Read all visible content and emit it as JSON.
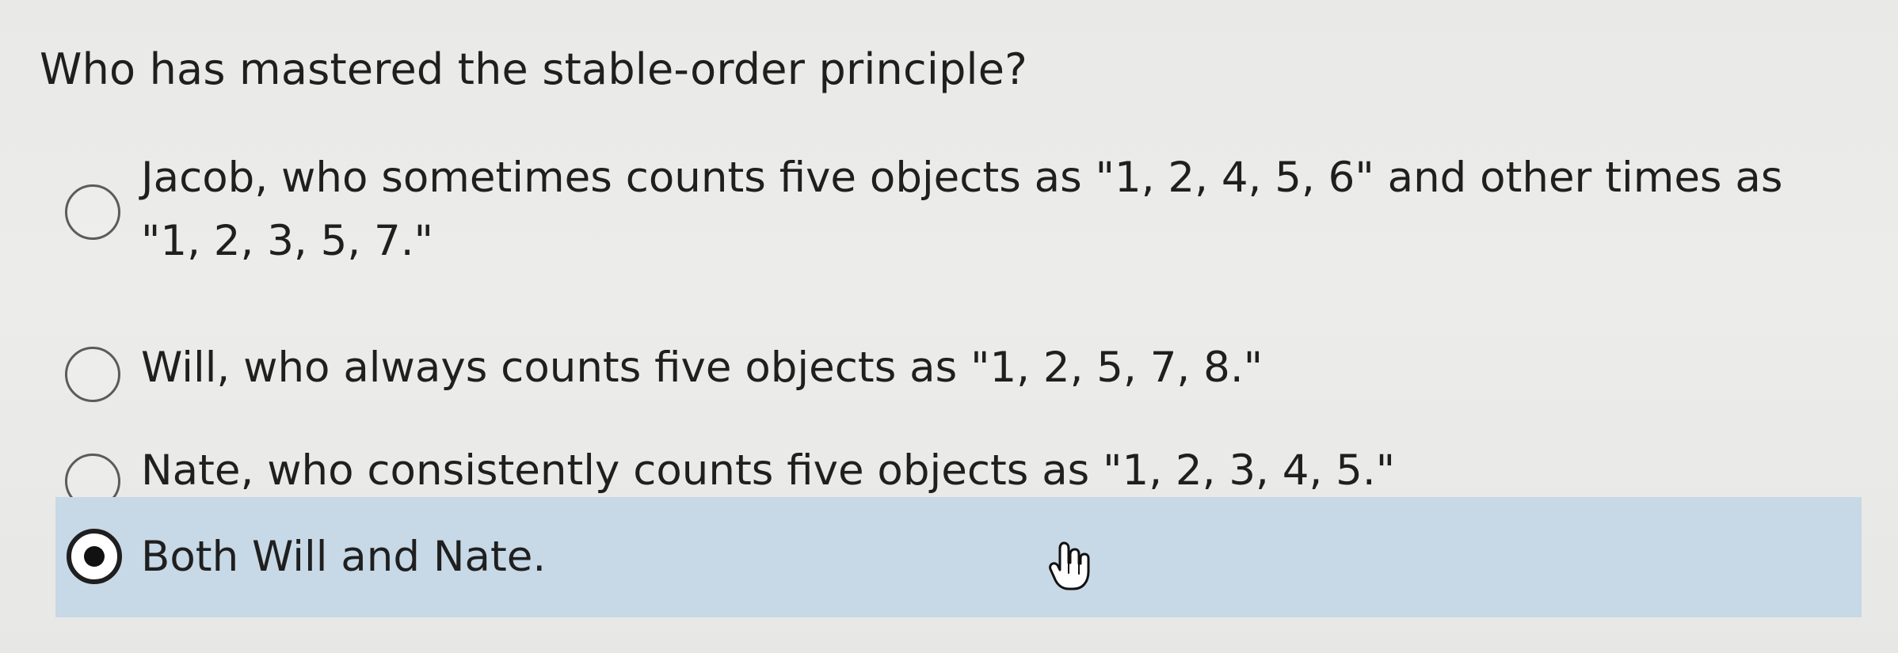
{
  "question": {
    "text": "Who has mastered the stable-order principle?"
  },
  "options": [
    {
      "line1": "Jacob, who sometimes counts five objects as \"1, 2, 4, 5, 6\" and other times as",
      "line2": "\"1, 2, 3, 5, 7.\"",
      "selected": false
    },
    {
      "text": "Will, who always counts five objects as \"1, 2, 5, 7, 8.\"",
      "selected": false
    },
    {
      "text": "Nate, who consistently counts five objects as \"1, 2, 3, 4, 5.\"",
      "selected": false
    },
    {
      "text": "Both Will and Nate.",
      "selected": true
    }
  ],
  "colors": {
    "selected_row_background": "#c7d8e6",
    "text": "#1f1f1f",
    "radio_border": "#5b5b5b"
  },
  "icons": {
    "cursor": "pointer-hand-icon"
  }
}
